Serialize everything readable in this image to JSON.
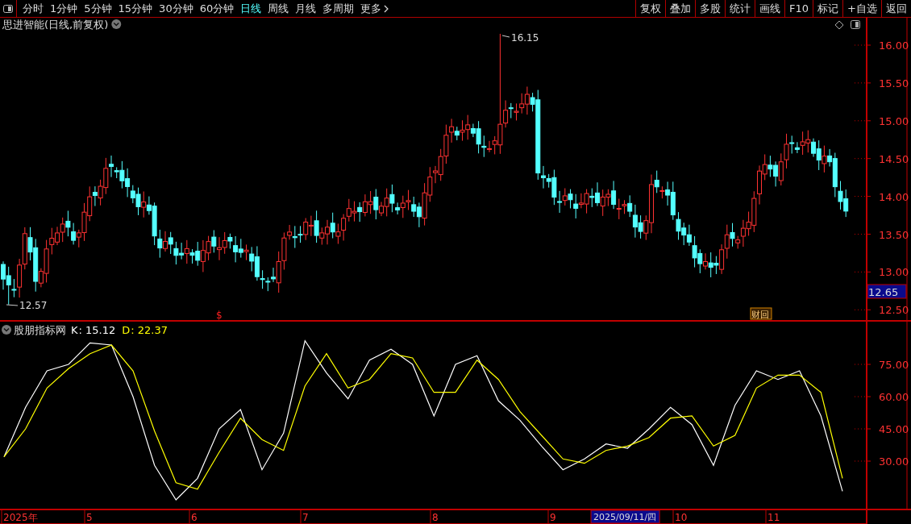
{
  "toolbar": {
    "periods": [
      {
        "label": "分时",
        "selected": false
      },
      {
        "label": "1分钟",
        "selected": false
      },
      {
        "label": "5分钟",
        "selected": false
      },
      {
        "label": "15分钟",
        "selected": false
      },
      {
        "label": "30分钟",
        "selected": false
      },
      {
        "label": "60分钟",
        "selected": false
      },
      {
        "label": "日线",
        "selected": true
      },
      {
        "label": "周线",
        "selected": false
      },
      {
        "label": "月线",
        "selected": false
      },
      {
        "label": "多周期",
        "selected": false
      }
    ],
    "more_label": "更多",
    "actions": [
      "复权",
      "叠加",
      "多股",
      "统计",
      "画线",
      "F10",
      "标记",
      "+自选",
      "返回"
    ]
  },
  "price_chart": {
    "title": "思进智能(日线,前复权)",
    "high_label": "16.15",
    "low_label": "12.57",
    "markers": [
      {
        "kind": "dollar",
        "text": "$"
      },
      {
        "kind": "badge",
        "text": "财回"
      }
    ],
    "y_axis_labels": [
      "16.00",
      "15.50",
      "15.00",
      "14.50",
      "14.00",
      "13.50",
      "13.00",
      "12.50"
    ],
    "current_price": "12.65"
  },
  "indicator": {
    "name": "股朋指标网",
    "legend": [
      {
        "name": "K",
        "readout": ": 15.12",
        "color": "#ffffff"
      },
      {
        "name": "D",
        "readout": ": 22.37",
        "color": "#ffff00"
      }
    ],
    "y_axis_labels": [
      "75.00",
      "60.00",
      "45.00",
      "30.00"
    ]
  },
  "date_axis": {
    "labels": [
      "2025年",
      "5",
      "6",
      "7",
      "8",
      "9",
      "10",
      "11"
    ],
    "cursor_date": "2025/09/11/四"
  }
}
